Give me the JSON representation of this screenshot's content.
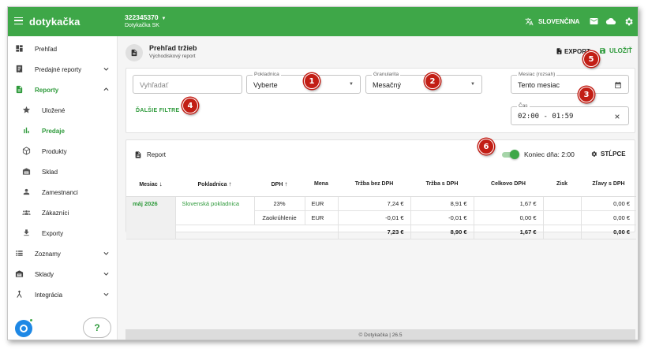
{
  "topbar": {
    "logo": "dotykačka",
    "account_id": "322345370",
    "account_org": "Dotykačka SK",
    "language": "SLOVENČINA"
  },
  "sidebar": {
    "items": [
      {
        "label": "Prehľad",
        "icon": "dashboard-icon"
      },
      {
        "label": "Predajné reporty",
        "icon": "receipt-icon"
      },
      {
        "label": "Reporty",
        "icon": "document-icon"
      },
      {
        "label": "Uložené",
        "icon": "star-icon"
      },
      {
        "label": "Predaje",
        "icon": "bar-chart-icon"
      },
      {
        "label": "Produkty",
        "icon": "cube-icon"
      },
      {
        "label": "Sklad",
        "icon": "warehouse-icon"
      },
      {
        "label": "Zamestnanci",
        "icon": "person-icon"
      },
      {
        "label": "Zákazníci",
        "icon": "people-icon"
      },
      {
        "label": "Exporty",
        "icon": "download-icon"
      },
      {
        "label": "Zoznamy",
        "icon": "list-icon"
      },
      {
        "label": "Sklady",
        "icon": "warehouse-icon"
      },
      {
        "label": "Integrácia",
        "icon": "merge-icon"
      }
    ],
    "help_label": "?"
  },
  "page": {
    "title": "Prehľad tržieb",
    "subtitle": "Východiskový report",
    "export_label": "EXPORT",
    "save_label": "ULOŽIŤ"
  },
  "filters": {
    "search_placeholder": "Vyhľadať",
    "register_label": "Pokladnica",
    "register_value": "Vyberte",
    "granularity_label": "Granularita",
    "granularity_value": "Mesačný",
    "month_label": "Mesiac (rozsah)",
    "month_value": "Tento mesiac",
    "time_label": "Čas",
    "time_value": "02:00 - 01:59",
    "more_filters": "ĎALŠIE FILTRE"
  },
  "callouts": [
    "1",
    "2",
    "3",
    "4",
    "5",
    "6"
  ],
  "report": {
    "title": "Report",
    "toggle_label": "Koniec dňa: 2:00",
    "columns_label": "STĹPCE",
    "headers": [
      "Mesiac",
      "Pokladnica",
      "DPH",
      "Mena",
      "Tržba bez DPH",
      "Tržba s DPH",
      "Celkovo DPH",
      "Zisk",
      "Zľavy s DPH"
    ],
    "group_month": "máj 2026",
    "group_register": "Slovenská pokladnica",
    "rows": [
      {
        "vat": "23%",
        "currency": "EUR",
        "net": "7,24 €",
        "gross": "8,91 €",
        "vat_total": "1,67 €",
        "profit": "",
        "discounts": "0,00 €"
      },
      {
        "vat": "Zaokrúhlenie",
        "currency": "EUR",
        "net": "-0,01 €",
        "gross": "-0,01 €",
        "vat_total": "0,00 €",
        "profit": "",
        "discounts": "0,00 €"
      }
    ],
    "total": {
      "net": "7,23 €",
      "gross": "8,90 €",
      "vat_total": "1,67 €",
      "profit": "",
      "discounts": "0,00 €"
    }
  },
  "footer": "© Dotykačka  | 26.5"
}
